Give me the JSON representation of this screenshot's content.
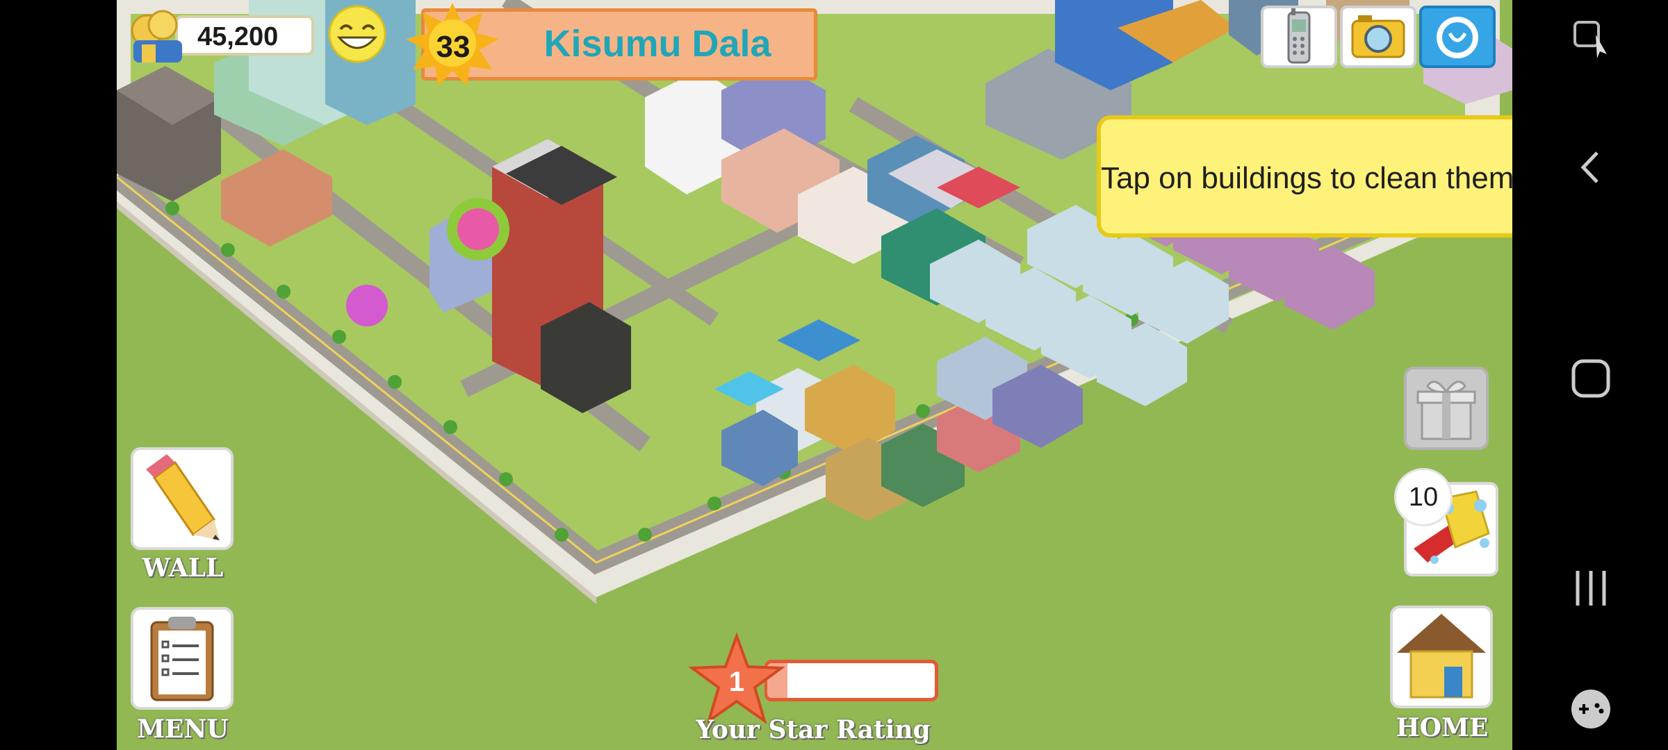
{
  "hud": {
    "coins": "45,200",
    "level": "33",
    "city_name": "Kisumu Dala"
  },
  "tooltip": {
    "text": "Tap on buildings to clean them."
  },
  "buttons": {
    "wall_label": "WALL",
    "menu_label": "MENU",
    "home_label": "HOME",
    "clean_count": "10"
  },
  "rating": {
    "stars": "1",
    "label": "Your Star Rating",
    "progress_fraction": 0.12
  },
  "icons": [
    "coins-icon",
    "smiley-icon",
    "level-sun-icon",
    "phone-icon",
    "camera-icon",
    "social-icon",
    "gift-icon",
    "clean-sponge-icon",
    "home-icon",
    "pencil-icon",
    "clipboard-icon",
    "rating-star-icon",
    "nav-screenshot-icon",
    "nav-back-icon",
    "nav-home-icon",
    "nav-recents-icon",
    "nav-game-icon"
  ],
  "colors": {
    "grass": "#92b853",
    "banner": "#f6b486",
    "city_text": "#20a6b8",
    "tooltip": "#fff27a",
    "rating": "#e25b33"
  }
}
